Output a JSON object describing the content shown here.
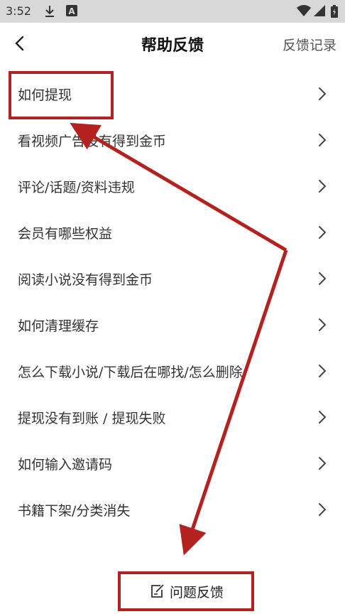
{
  "status_bar": {
    "time": "3:52",
    "icons": [
      "download-icon",
      "a-badge-icon",
      "wifi-icon",
      "signal-icon",
      "battery-icon"
    ]
  },
  "header": {
    "back_icon": "chevron-left-icon",
    "title": "帮助反馈",
    "right_link": "反馈记录"
  },
  "faq": {
    "items": [
      {
        "label": "如何提现"
      },
      {
        "label": "看视频广告没有得到金币"
      },
      {
        "label": "评论/话题/资料违规"
      },
      {
        "label": "会员有哪些权益"
      },
      {
        "label": "阅读小说没有得到金币"
      },
      {
        "label": "如何清理缓存"
      },
      {
        "label": "怎么下载小说/下载后在哪找/怎么删除"
      },
      {
        "label": "提现没有到账 / 提现失败"
      },
      {
        "label": "如何输入邀请码"
      },
      {
        "label": "书籍下架/分类消失"
      }
    ]
  },
  "bottom": {
    "icon": "edit-note-icon",
    "label": "问题反馈"
  },
  "colors": {
    "annotation_red": "#b3221f",
    "text": "#333333",
    "status_bar_bg": "#d8d8d8"
  }
}
